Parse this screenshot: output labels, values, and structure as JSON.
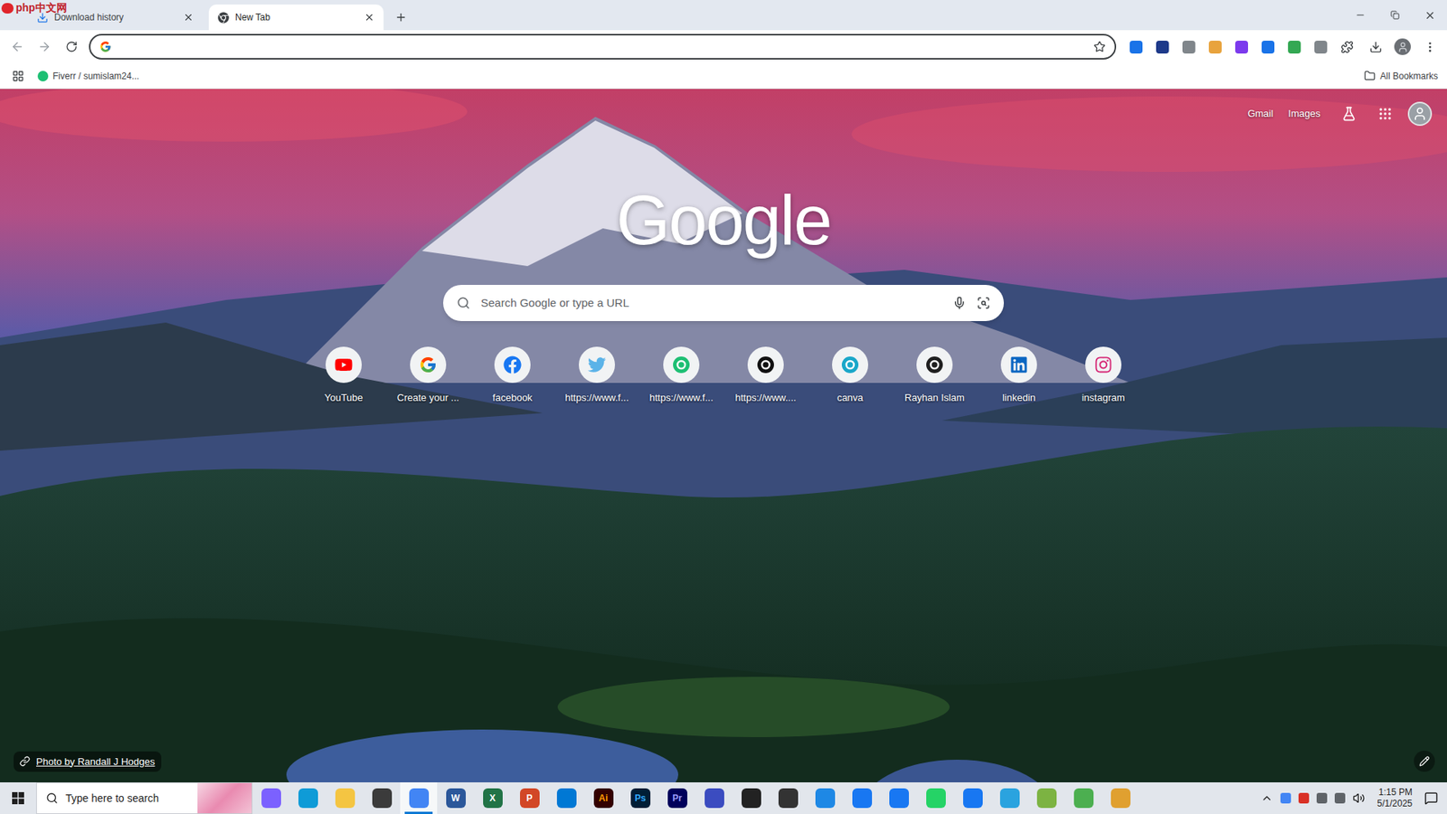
{
  "watermark": "php中文网",
  "tabs": [
    {
      "label": "Download history",
      "selected": false,
      "kind": "download"
    },
    {
      "label": "New Tab",
      "selected": true,
      "kind": "chrome"
    }
  ],
  "extensions": [
    {
      "color": "#1a73e8"
    },
    {
      "color": "#1e3a8a"
    },
    {
      "color": "#80868b"
    },
    {
      "color": "#e8a33d"
    },
    {
      "color": "#7c3aed"
    },
    {
      "color": "#1a73e8"
    },
    {
      "color": "#34a853"
    },
    {
      "color": "#80868b"
    }
  ],
  "bookmarks": {
    "items": [
      {
        "label": "Fiverr / sumislam24...",
        "color": "#1dbf73"
      }
    ],
    "all_bookmarks": "All Bookmarks"
  },
  "ntp": {
    "links": [
      "Gmail",
      "Images"
    ],
    "logo": "Google",
    "search_placeholder": "Search Google or type a URL",
    "shortcuts": [
      {
        "label": "YouTube",
        "kind": "youtube",
        "color": "#ff0000"
      },
      {
        "label": "Create your ...",
        "kind": "google",
        "color": "#4285f4"
      },
      {
        "label": "facebook",
        "kind": "facebook",
        "color": "#1877f2"
      },
      {
        "label": "https://www.f...",
        "kind": "twitter",
        "color": "#5bb3e8"
      },
      {
        "label": "https://www.f...",
        "kind": "circle",
        "color": "#1dbf73"
      },
      {
        "label": "https://www....",
        "kind": "circle",
        "color": "#111111"
      },
      {
        "label": "canva",
        "kind": "circle",
        "color": "#19a7c9"
      },
      {
        "label": "Rayhan Islam",
        "kind": "circle",
        "color": "#1f1f1f"
      },
      {
        "label": "linkedin",
        "kind": "linkedin",
        "color": "#0a66c2"
      },
      {
        "label": "instagram",
        "kind": "instagram",
        "color": "#d62976"
      }
    ],
    "photo_credit": "Photo by Randall J Hodges"
  },
  "taskbar": {
    "search_placeholder": "Type here to search",
    "apps": [
      {
        "color": "#7b61ff",
        "active": false
      },
      {
        "color": "#0f9bd7",
        "active": false
      },
      {
        "color": "#f4c542",
        "active": false
      },
      {
        "color": "#3b3b3b",
        "active": false
      },
      {
        "color": "#4285f4",
        "active": true
      },
      {
        "color": "#2b579a",
        "active": false,
        "label": "W",
        "text_color": "#ffffff"
      },
      {
        "color": "#217346",
        "active": false,
        "label": "X",
        "text_color": "#ffffff"
      },
      {
        "color": "#d24726",
        "active": false,
        "label": "P",
        "text_color": "#ffffff"
      },
      {
        "color": "#0078d4",
        "active": false
      },
      {
        "color": "#330000",
        "active": false,
        "label": "Ai",
        "text_color": "#ff9a00"
      },
      {
        "color": "#001e36",
        "active": false,
        "label": "Ps",
        "text_color": "#31a8ff"
      },
      {
        "color": "#00005b",
        "active": false,
        "label": "Pr",
        "text_color": "#9999ff"
      },
      {
        "color": "#3b4cc0",
        "active": false
      },
      {
        "color": "#222222",
        "active": false
      },
      {
        "color": "#333333",
        "active": false
      },
      {
        "color": "#1e88e5",
        "active": false
      },
      {
        "color": "#1877f2",
        "active": false
      },
      {
        "color": "#1877f2",
        "active": false
      },
      {
        "color": "#25d366",
        "active": false
      },
      {
        "color": "#1877f2",
        "active": false
      },
      {
        "color": "#2aa3df",
        "active": false
      },
      {
        "color": "#7cb342",
        "active": false
      },
      {
        "color": "#4caf50",
        "active": false
      },
      {
        "color": "#e0a030",
        "active": false
      }
    ],
    "tray_icons": [
      {
        "color": "#4285f4"
      },
      {
        "color": "#d93025"
      },
      {
        "color": "#5f6368"
      },
      {
        "color": "#5f6368"
      }
    ],
    "time": "1:15 PM",
    "date": "5/1/2025"
  }
}
